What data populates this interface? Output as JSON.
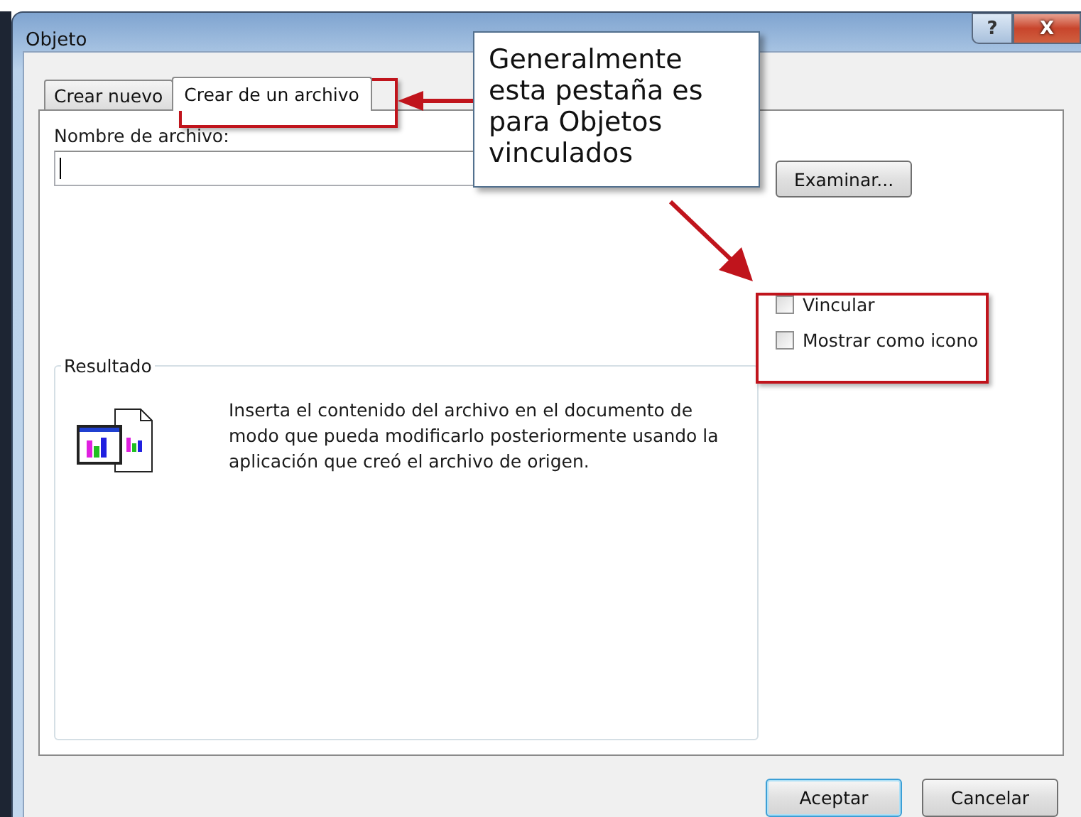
{
  "window": {
    "title": "Objeto",
    "controls": [
      {
        "kind": "help",
        "label": "?"
      },
      {
        "kind": "close",
        "label": "X"
      }
    ]
  },
  "tabs": [
    {
      "label": "Crear nuevo",
      "selected": false
    },
    {
      "label": "Crear de un archivo",
      "selected": true
    }
  ],
  "file_name": {
    "label": "Nombre de archivo:"
  },
  "browse_button": "Examinar...",
  "options": [
    {
      "label": "Vincular",
      "checked": false
    },
    {
      "label": "Mostrar como icono",
      "checked": false
    }
  ],
  "result": {
    "title": "Resultado",
    "text": "Inserta el contenido del archivo en el documento de modo que pueda modificarlo posteriormente usando la aplicación que creó el archivo de origen."
  },
  "buttons": [
    {
      "label": "Aceptar",
      "default": true
    },
    {
      "label": "Cancelar",
      "default": false
    }
  ],
  "callout": {
    "text": "Generalmente esta pestaña es para Objetos vinculados"
  }
}
